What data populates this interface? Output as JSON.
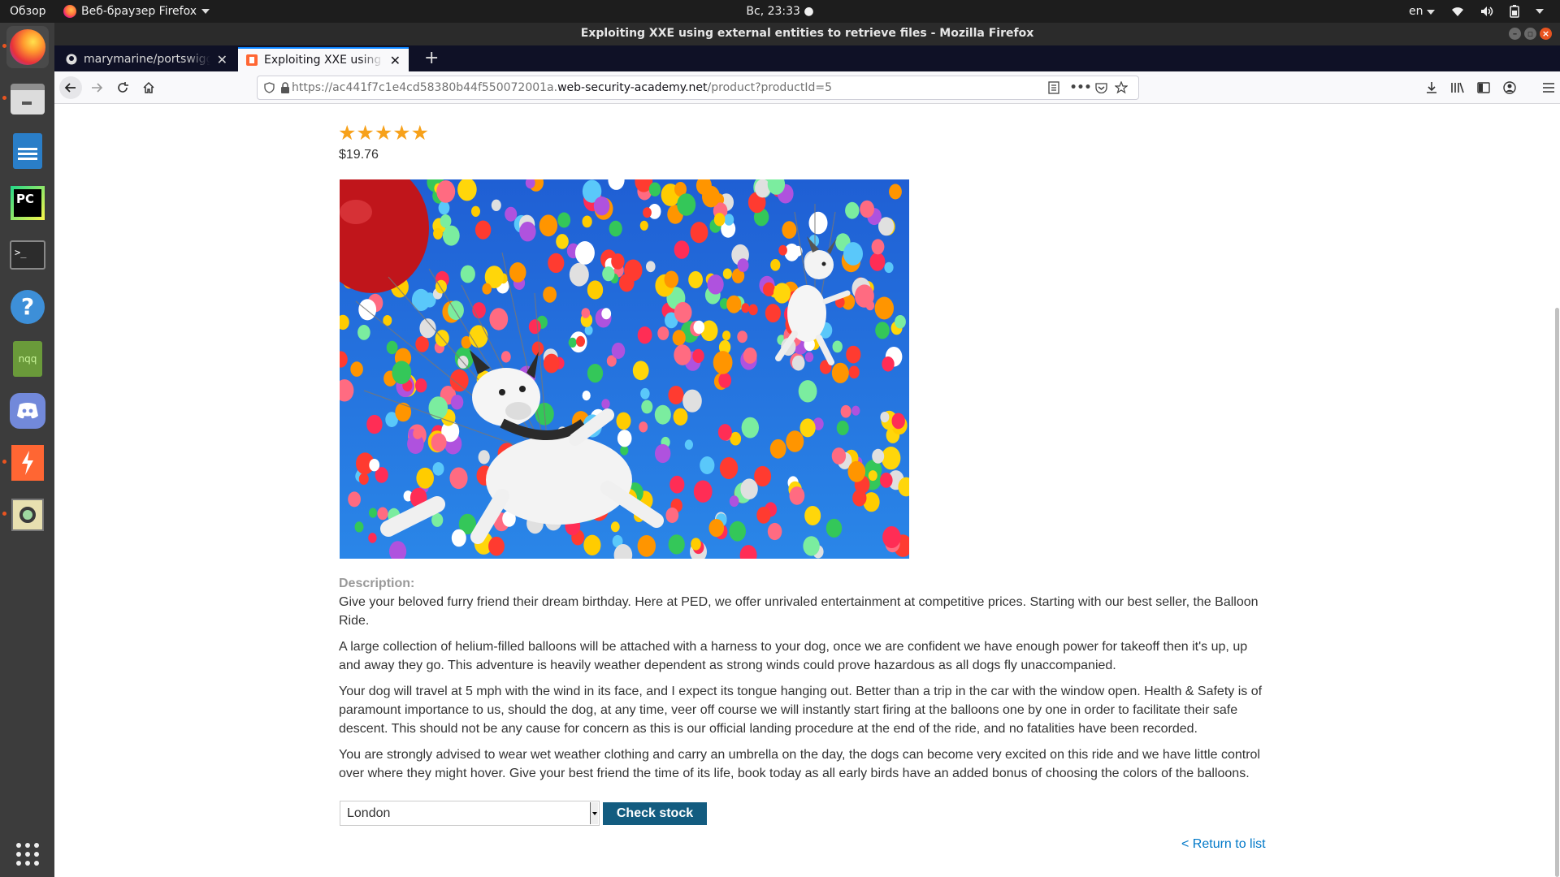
{
  "topbar": {
    "overview": "Обзор",
    "app_menu": "Веб-браузер Firefox",
    "clock": "Вс, 23:33 ●",
    "lang": "en"
  },
  "dock": {
    "items": [
      "firefox-icon",
      "files-icon",
      "libreoffice-writer-icon",
      "pycharm-icon",
      "terminal-icon",
      "help-icon",
      "notepadqq-icon",
      "discord-icon",
      "burpsuite-icon",
      "image-viewer-icon",
      "show-apps-icon"
    ],
    "notepadqq_label": "nqq",
    "pycharm_label": "PC"
  },
  "window": {
    "title": "Exploiting XXE using external entities to retrieve files - Mozilla Firefox"
  },
  "tabs": [
    {
      "title": "marymarine/portswigger",
      "active": false
    },
    {
      "title": "Exploiting XXE using external entities",
      "active": true
    }
  ],
  "url": {
    "prefix": "https://ac441f7c1e4cd58380b44f550072001a.",
    "host": "web-security-academy.net",
    "path": "/product?productId=5"
  },
  "product": {
    "rating": "★★★★★",
    "price": "$19.76",
    "description_label": "Description:",
    "paragraphs": [
      "Give your beloved furry friend their dream birthday. Here at PED, we offer unrivaled entertainment at competitive prices. Starting with our best seller, the Balloon Ride.",
      "A large collection of helium-filled balloons will be attached with a harness to your dog, once we are confident we have enough power for takeoff then it's up, up and away they go. This adventure is heavily weather dependent as strong winds could prove hazardous as all dogs fly unaccompanied.",
      "Your dog will travel at 5 mph with the wind in its face, and I expect its tongue hanging out. Better than a trip in the car with the window open. Health & Safety is of paramount importance to us, should the dog, at any time, veer off course we will instantly start firing at the balloons one by one in order to facilitate their safe descent. This should not be any cause for concern as this is our official landing procedure at the end of the ride, and no fatalities have been recorded.",
      "You are strongly advised to wear wet weather clothing and carry an umbrella on the day, the dogs can become very excited on this ride and we have little control over where they might hover. Give your best friend the time of its life, book today as all early birds have an added bonus of choosing the colors of the balloons."
    ],
    "store_selected": "London",
    "check_button": "Check stock",
    "return_link": "< Return to list"
  },
  "colors": {
    "accent": "#135c80",
    "link": "#0078c8",
    "stars": "#f7a11a",
    "ubuntu_orange": "#e95420"
  }
}
